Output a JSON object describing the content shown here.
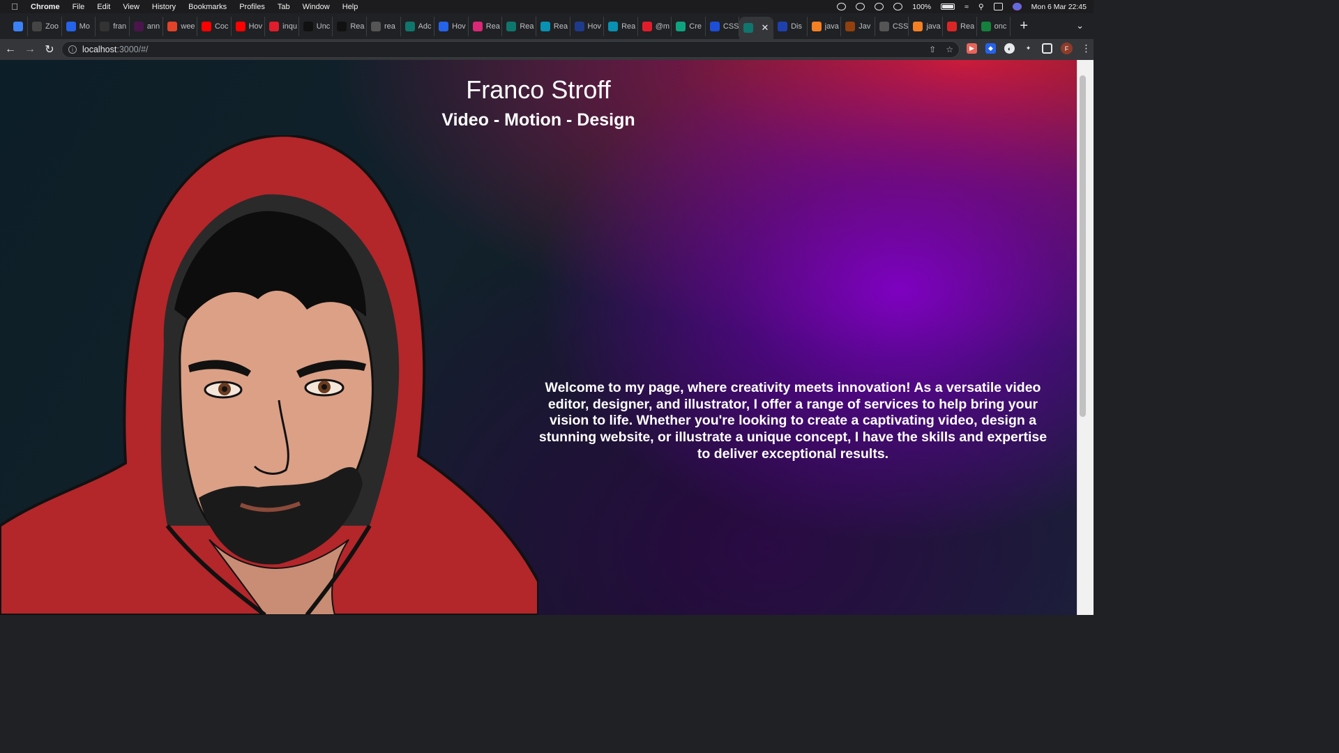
{
  "menubar": {
    "app": "Chrome",
    "items": [
      "File",
      "Edit",
      "View",
      "History",
      "Bookmarks",
      "Profiles",
      "Tab",
      "Window",
      "Help"
    ],
    "battery": "100%",
    "datetime": "Mon 6 Mar  22:45"
  },
  "tabs": [
    {
      "label": "",
      "icon": "pinned-gem-icon",
      "color": "#3b82f6"
    },
    {
      "label": "Zoo",
      "icon": "wix-icon",
      "color": "#444444"
    },
    {
      "label": "Mo",
      "icon": "z-icon",
      "color": "#2563eb"
    },
    {
      "label": "fran",
      "icon": "github-icon",
      "color": "#333333"
    },
    {
      "label": "ann",
      "icon": "slack-icon",
      "color": "#4a154b"
    },
    {
      "label": "wee",
      "icon": "gitlab-icon",
      "color": "#e24329"
    },
    {
      "label": "Coc",
      "icon": "youtube-icon",
      "color": "#ff0000"
    },
    {
      "label": "Hov",
      "icon": "youtube-icon",
      "color": "#ff0000"
    },
    {
      "label": "inqu",
      "icon": "red-square-icon",
      "color": "#e11d2c"
    },
    {
      "label": "Unc",
      "icon": "medium-icon",
      "color": "#111111"
    },
    {
      "label": "Rea",
      "icon": "medium-icon",
      "color": "#111111"
    },
    {
      "label": "rea",
      "icon": "square-icon",
      "color": "#555555"
    },
    {
      "label": "Adc",
      "icon": "react-icon",
      "color": "#0f766e"
    },
    {
      "label": "Hov",
      "icon": "google-icon",
      "color": "#2563eb"
    },
    {
      "label": "Rea",
      "icon": "record-icon",
      "color": "#db2777"
    },
    {
      "label": "Rea",
      "icon": "react-icon",
      "color": "#0f766e"
    },
    {
      "label": "Rea",
      "icon": "react-icon",
      "color": "#0891b2"
    },
    {
      "label": "Hov",
      "icon": "a-icon",
      "color": "#1e3a8a"
    },
    {
      "label": "Rea",
      "icon": "react-icon",
      "color": "#0891b2"
    },
    {
      "label": "@m",
      "icon": "red-square-icon",
      "color": "#e11d2c"
    },
    {
      "label": "Cre",
      "icon": "chatgpt-icon",
      "color": "#10a37f"
    },
    {
      "label": "CSS",
      "icon": "globe-icon",
      "color": "#1d4ed8"
    },
    {
      "label": "",
      "icon": "react-icon",
      "color": "#0f766e",
      "active": true
    },
    {
      "label": "Dis",
      "icon": "infinity-icon",
      "color": "#1e40af"
    },
    {
      "label": "java",
      "icon": "stackoverflow-icon",
      "color": "#f48024"
    },
    {
      "label": "Jav",
      "icon": "avatar-icon",
      "color": "#92400e"
    },
    {
      "label": "CSS",
      "icon": "dots-icon",
      "color": "#555555"
    },
    {
      "label": "java",
      "icon": "stackoverflow-icon",
      "color": "#f48024"
    },
    {
      "label": "Rea",
      "icon": "lines-icon",
      "color": "#dc2626"
    },
    {
      "label": "onc",
      "icon": "w-icon",
      "color": "#15803d"
    }
  ],
  "toolbar": {
    "url_host": "localhost",
    "url_path": ":3000/#/"
  },
  "page": {
    "title": "Franco Stroff",
    "subtitle": "Video - Motion - Design",
    "intro": "Welcome to my page, where creativity meets innovation! As a versatile video editor, designer, and illustrator, I offer a range of services to help bring your vision to life. Whether you're looking to create a captivating video, design a stunning website, or illustrate a unique concept, I have the skills and expertise to deliver exceptional results."
  },
  "colors": {
    "hoodie": "#b3262a",
    "skin": "#dba085",
    "hair": "#0d0d0d",
    "accent_purple": "#7a00c0",
    "accent_red": "#d81e32"
  }
}
